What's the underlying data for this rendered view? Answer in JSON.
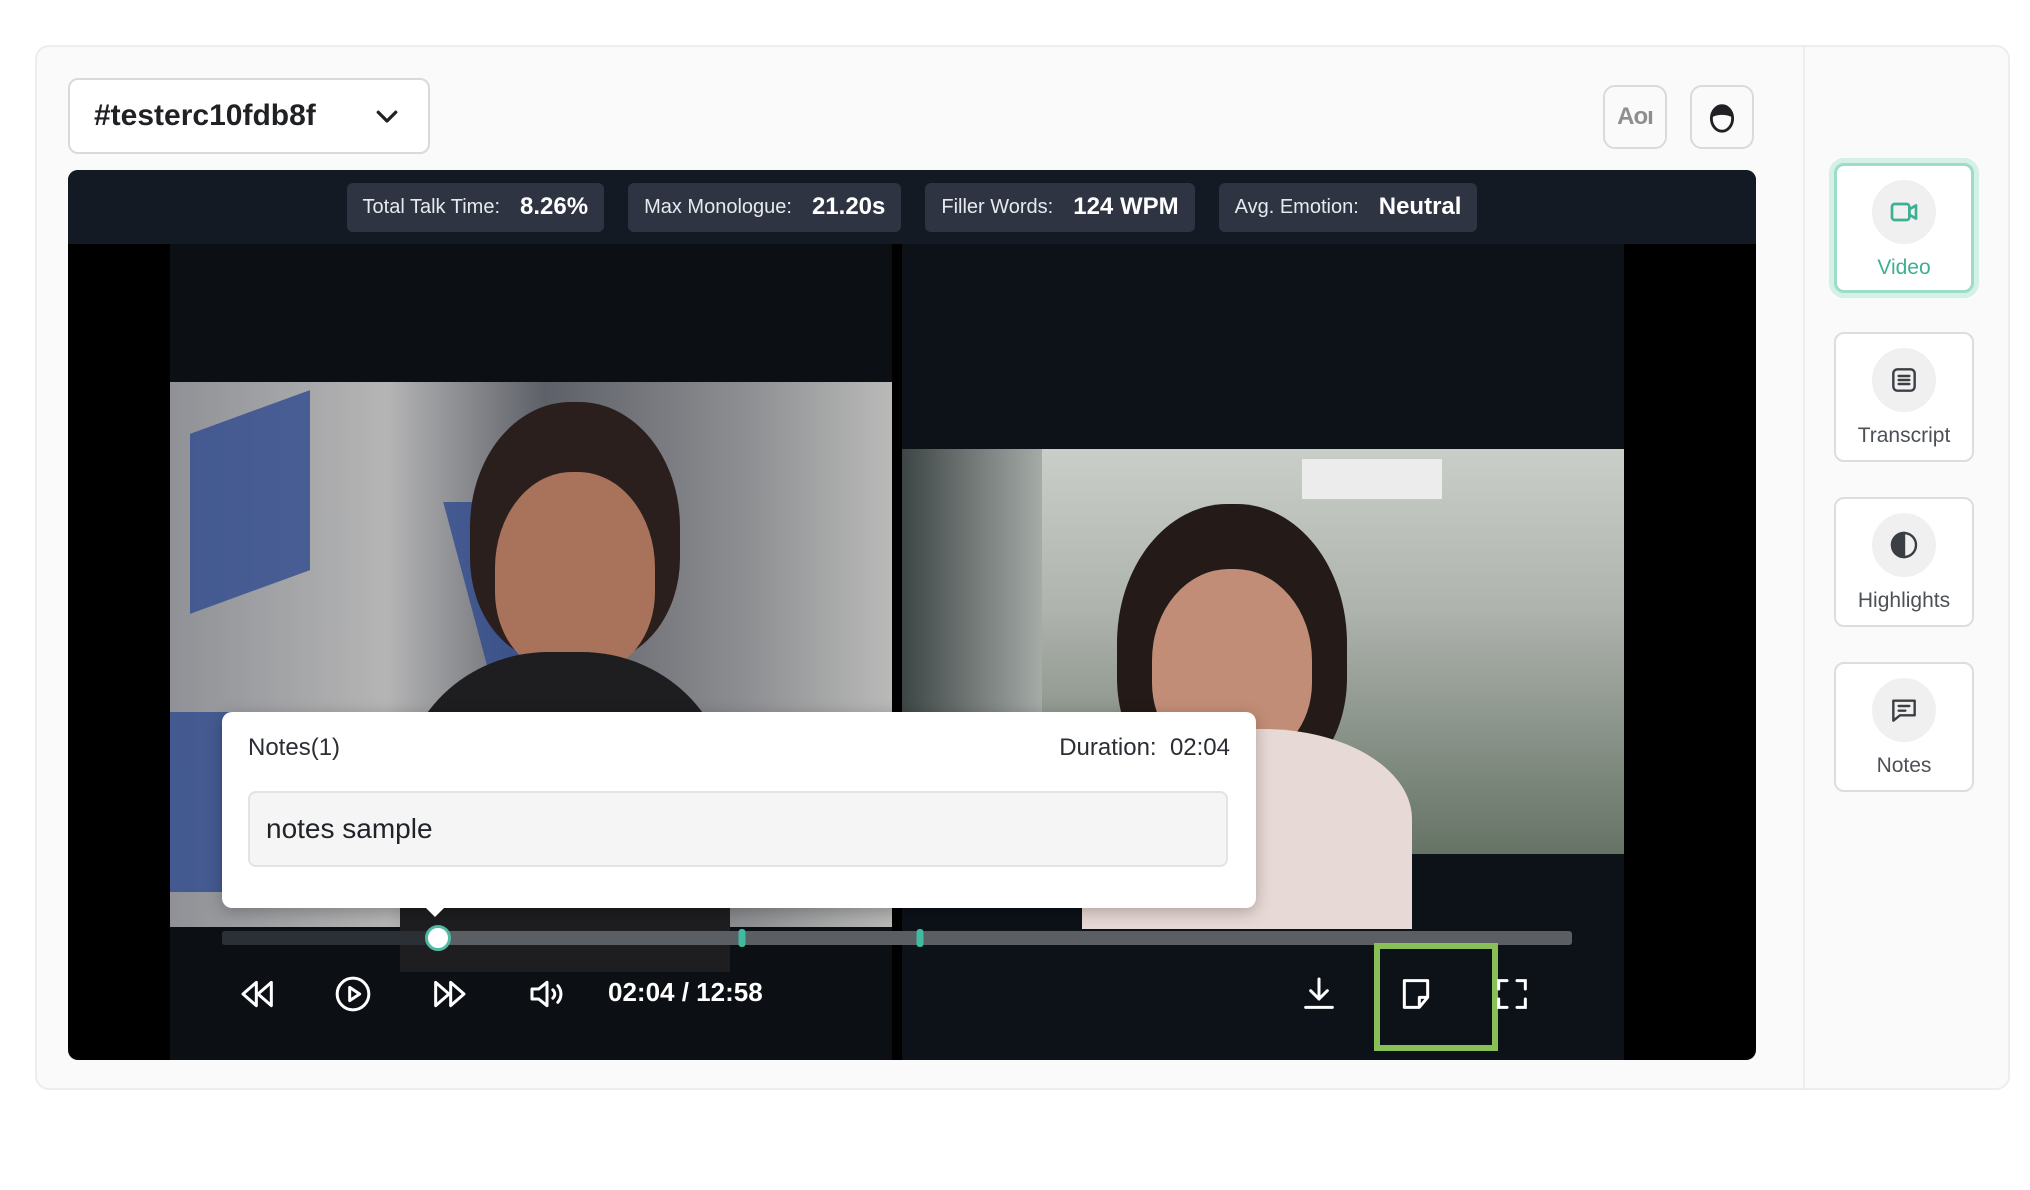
{
  "header": {
    "selector_value": "#testerc10fdb8f",
    "aoi_label": "Aoı"
  },
  "stats": [
    {
      "label": "Total Talk Time:",
      "value": "8.26%"
    },
    {
      "label": "Max Monologue:",
      "value": "21.20s"
    },
    {
      "label": "Filler Words:",
      "value": "124 WPM"
    },
    {
      "label": "Avg. Emotion:",
      "value": "Neutral"
    }
  ],
  "notes": {
    "title": "Notes(1)",
    "duration_label": "Duration:",
    "duration_value": "02:04",
    "text": "notes sample"
  },
  "player": {
    "time_display": "02:04 / 12:58",
    "progress_fraction": 0.16,
    "marker_fractions": [
      0.385,
      0.517
    ]
  },
  "sidebar": {
    "items": [
      {
        "label": "Video",
        "icon": "video-icon",
        "active": true
      },
      {
        "label": "Transcript",
        "icon": "transcript-icon",
        "active": false
      },
      {
        "label": "Highlights",
        "icon": "highlights-icon",
        "active": false
      },
      {
        "label": "Notes",
        "icon": "notes-icon",
        "active": false
      }
    ]
  },
  "colors": {
    "accent": "#3daf93",
    "highlight_box": "#88c057",
    "stats_bar": "#141a24"
  }
}
